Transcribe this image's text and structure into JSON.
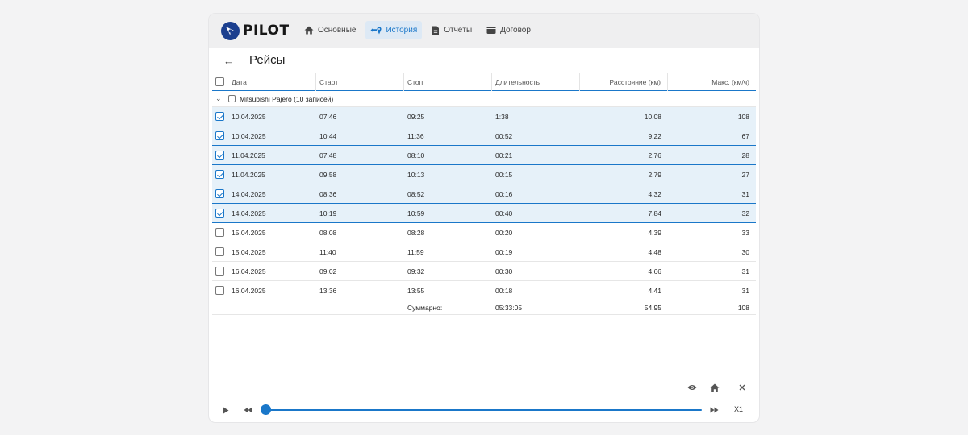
{
  "app": {
    "logo_text": "PILOT",
    "brand_color": "#1b3f8f",
    "accent_color": "#1a77c9"
  },
  "nav": [
    {
      "label": "Основные",
      "icon": "home-icon",
      "active": false
    },
    {
      "label": "История",
      "icon": "route-icon",
      "active": true
    },
    {
      "label": "Отчёты",
      "icon": "document-icon",
      "active": false
    },
    {
      "label": "Договор",
      "icon": "wallet-icon",
      "active": false
    }
  ],
  "page": {
    "title": "Рейсы",
    "back_icon": "arrow-left-icon"
  },
  "table": {
    "columns": [
      "Дата",
      "Старт",
      "Стоп",
      "Длительность",
      "Расстояние (км)",
      "Макс. (км/ч)"
    ],
    "group": {
      "label": "Mitsubishi Pajero (10 записей)",
      "expanded": true,
      "icon": "chevron-down-icon"
    },
    "rows": [
      {
        "date": "10.04.2025",
        "start": "07:46",
        "stop": "09:25",
        "duration": "1:38",
        "distance": "10.08",
        "max": "108",
        "checked": true
      },
      {
        "date": "10.04.2025",
        "start": "10:44",
        "stop": "11:36",
        "duration": "00:52",
        "distance": "9.22",
        "max": "67",
        "checked": true
      },
      {
        "date": "11.04.2025",
        "start": "07:48",
        "stop": "08:10",
        "duration": "00:21",
        "distance": "2.76",
        "max": "28",
        "checked": true
      },
      {
        "date": "11.04.2025",
        "start": "09:58",
        "stop": "10:13",
        "duration": "00:15",
        "distance": "2.79",
        "max": "27",
        "checked": true
      },
      {
        "date": "14.04.2025",
        "start": "08:36",
        "stop": "08:52",
        "duration": "00:16",
        "distance": "4.32",
        "max": "31",
        "checked": true
      },
      {
        "date": "14.04.2025",
        "start": "10:19",
        "stop": "10:59",
        "duration": "00:40",
        "distance": "7.84",
        "max": "32",
        "checked": true
      },
      {
        "date": "15.04.2025",
        "start": "08:08",
        "stop": "08:28",
        "duration": "00:20",
        "distance": "4.39",
        "max": "33",
        "checked": false
      },
      {
        "date": "15.04.2025",
        "start": "11:40",
        "stop": "11:59",
        "duration": "00:19",
        "distance": "4.48",
        "max": "30",
        "checked": false
      },
      {
        "date": "16.04.2025",
        "start": "09:02",
        "stop": "09:32",
        "duration": "00:30",
        "distance": "4.66",
        "max": "31",
        "checked": false
      },
      {
        "date": "16.04.2025",
        "start": "13:36",
        "stop": "13:55",
        "duration": "00:18",
        "distance": "4.41",
        "max": "31",
        "checked": false
      }
    ],
    "totals": {
      "label": "Суммарно:",
      "duration": "05:33:05",
      "distance": "54.95",
      "max": "108"
    }
  },
  "player": {
    "speed": "X1",
    "progress": 0,
    "tools": [
      "eye-icon",
      "home-icon",
      "close-icon"
    ],
    "controls": [
      "play-icon",
      "rewind-icon",
      "fast-forward-icon"
    ]
  }
}
